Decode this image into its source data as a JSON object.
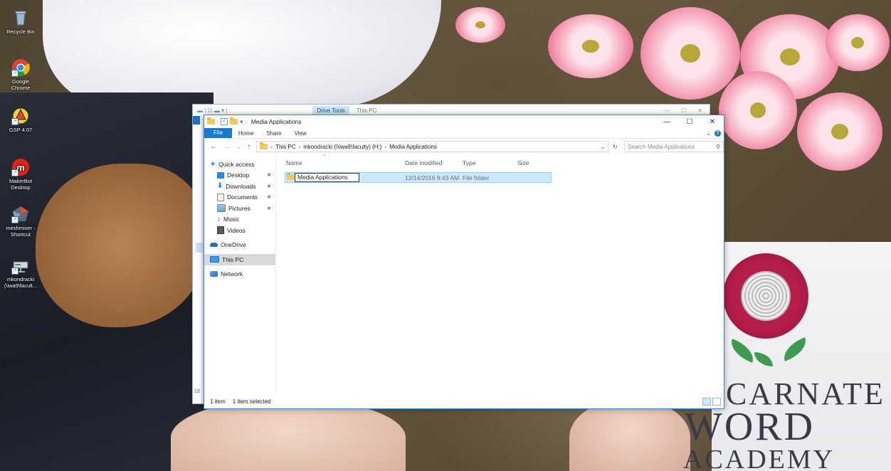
{
  "desktop": {
    "icons": [
      {
        "label": "Recycle Bin",
        "icon": "recycle-bin-icon"
      },
      {
        "label": "Google Chrome",
        "icon": "chrome-icon"
      },
      {
        "label": "GSP 4.07",
        "icon": "gsp-icon"
      },
      {
        "label": "MakerBot Desktop",
        "icon": "makerbot-icon"
      },
      {
        "label": "meshmixer - Shortcut",
        "icon": "meshmixer-icon"
      },
      {
        "label": "mkondracki (\\iwa9\\facult...",
        "icon": "network-drive-icon"
      }
    ],
    "wallpaper_logo": {
      "line1": "CARNATE",
      "line2": "WORD",
      "line3": "ACADEMY"
    }
  },
  "back_window": {
    "context_tab": "Drive Tools",
    "title": "This PC",
    "status_partial": "13"
  },
  "window": {
    "title": "Media Applications",
    "controls": {
      "minimize": "—",
      "maximize": "☐",
      "close": "✕"
    },
    "ribbon": {
      "file": "File",
      "tabs": [
        "Home",
        "Share",
        "View"
      ]
    },
    "address": {
      "segments": [
        "This PC",
        "mkondracki (\\\\iwa9\\faculty) (H:)",
        "Media Applications"
      ]
    },
    "search": {
      "placeholder": "Search Media Applications"
    },
    "nav_pane": {
      "items": [
        {
          "label": "Quick access",
          "icon": "star-icon",
          "sub": false,
          "pinned": false
        },
        {
          "label": "Desktop",
          "icon": "desktop-icon",
          "sub": true,
          "pinned": true
        },
        {
          "label": "Downloads",
          "icon": "download-icon",
          "sub": true,
          "pinned": true
        },
        {
          "label": "Documents",
          "icon": "documents-icon",
          "sub": true,
          "pinned": true
        },
        {
          "label": "Pictures",
          "icon": "pictures-icon",
          "sub": true,
          "pinned": true
        },
        {
          "label": "Music",
          "icon": "music-icon",
          "sub": true,
          "pinned": false
        },
        {
          "label": "Videos",
          "icon": "videos-icon",
          "sub": true,
          "pinned": false
        },
        {
          "label": "OneDrive",
          "icon": "onedrive-icon",
          "sub": false,
          "pinned": false
        },
        {
          "label": "This PC",
          "icon": "this-pc-icon",
          "sub": false,
          "pinned": false
        },
        {
          "label": "Network",
          "icon": "network-icon",
          "sub": false,
          "pinned": false
        }
      ]
    },
    "columns": [
      "Name",
      "Date modified",
      "Type",
      "Size"
    ],
    "files": [
      {
        "name": "Media Applications",
        "date": "12/14/2016 9:43 AM",
        "type": "File folder",
        "size": ""
      }
    ],
    "status": {
      "count": "1 item",
      "selection": "1 item selected"
    }
  },
  "colors": {
    "accent": "#1979ca",
    "selection": "#cce8ff",
    "folder": "#f4c95a"
  }
}
